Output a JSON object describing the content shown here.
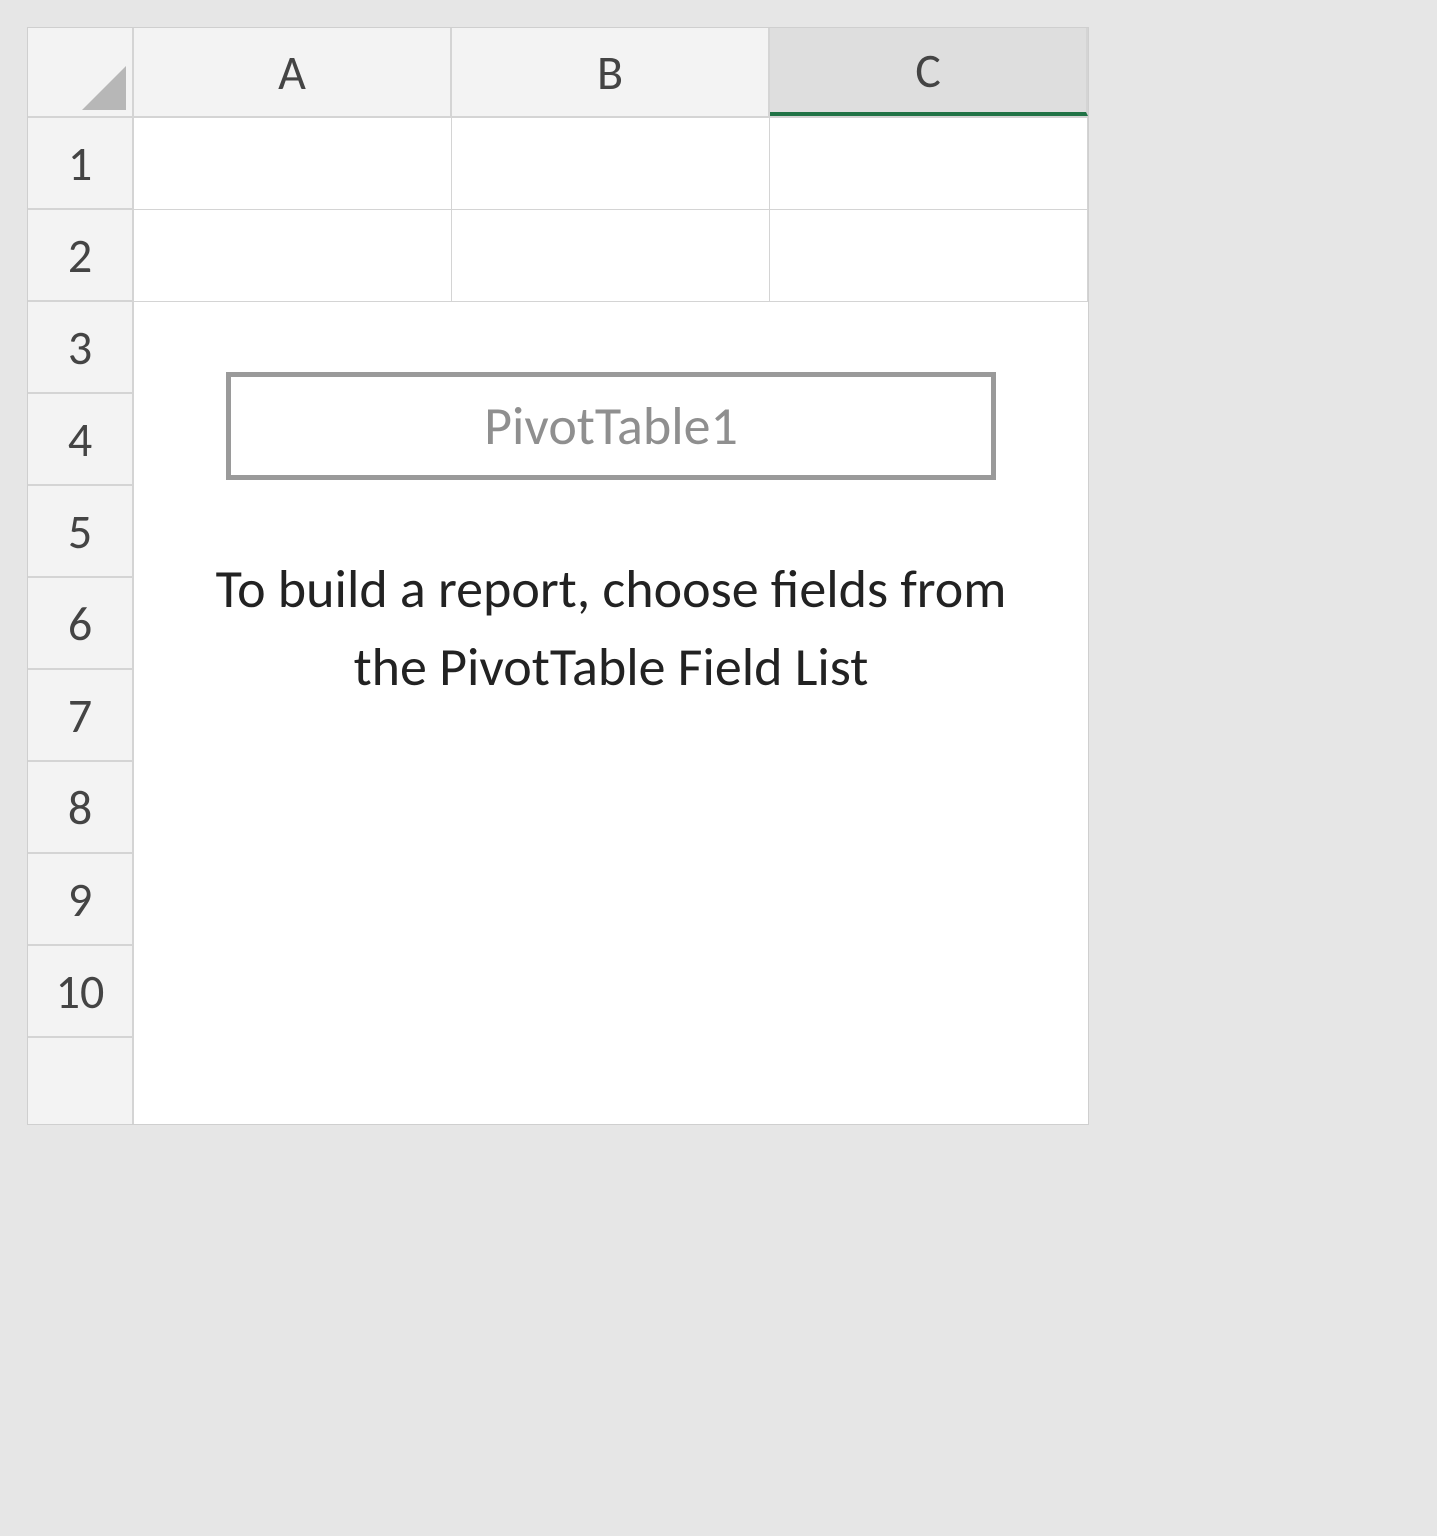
{
  "columns": [
    "A",
    "B",
    "C"
  ],
  "rows": [
    "1",
    "2",
    "3",
    "4",
    "5",
    "6",
    "7",
    "8",
    "9",
    "10"
  ],
  "selected_column_index": 2,
  "pivot_placeholder": {
    "name": "PivotTable1",
    "instruction": "To build a report, choose fields from the PivotTable Field List"
  }
}
